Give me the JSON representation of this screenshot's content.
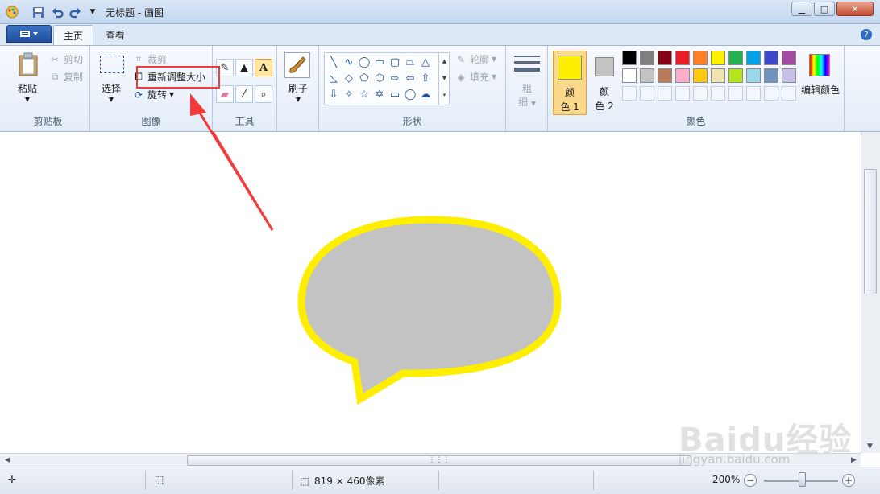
{
  "window": {
    "title": "无标题 - 画图"
  },
  "tabs": [
    {
      "label": "主页"
    },
    {
      "label": "查看"
    }
  ],
  "clipboard": {
    "paste": "粘贴",
    "cut": "剪切",
    "copy": "复制",
    "group": "剪贴板"
  },
  "image": {
    "select": "选择",
    "crop": "裁剪",
    "resize": "重新调整大小",
    "rotate": "旋转",
    "group": "图像"
  },
  "tools": {
    "group": "工具",
    "selected": "text-tool"
  },
  "brushes": {
    "label": "刷子"
  },
  "shapes": {
    "outline": "轮廓",
    "fill": "填充",
    "group": "形状"
  },
  "size": {
    "label_line1": "粗",
    "label_line2": "细"
  },
  "colors": {
    "color1_line1": "颜",
    "color1_line2": "色 1",
    "color2_line1": "颜",
    "color2_line2": "色 2",
    "color1_value": "#ffee00",
    "color2_value": "#c3c3c3",
    "edit": "编辑颜色",
    "group": "颜色",
    "palette_row1": [
      "#000000",
      "#7f7f7f",
      "#880015",
      "#ed1c24",
      "#ff7f27",
      "#fff200",
      "#22b14c",
      "#00a2e8",
      "#3f48cc",
      "#a349a4"
    ],
    "palette_row2": [
      "#ffffff",
      "#c3c3c3",
      "#b97a57",
      "#ffaec9",
      "#ffc90e",
      "#efe4b0",
      "#b5e61d",
      "#99d9ea",
      "#7092be",
      "#c8bfe7"
    ]
  },
  "canvas": {
    "bubble_fill": "#c3c3c3",
    "bubble_stroke": "#ffee00",
    "annotation_color": "#f23c3c"
  },
  "status": {
    "dimensions": "819 × 460像素",
    "zoom": "200%"
  },
  "watermark": {
    "line1": "Baidu经验",
    "line2": "jingyan.baidu.com"
  }
}
